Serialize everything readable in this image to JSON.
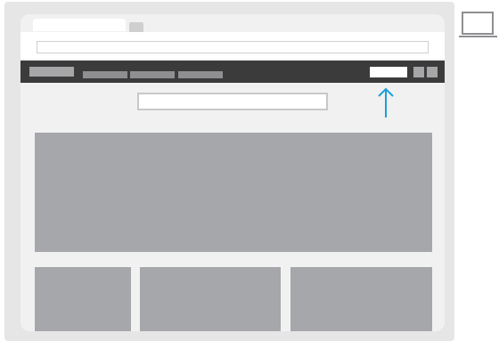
{
  "browser": {
    "tabs": [
      {
        "label": "",
        "active": true
      },
      {
        "label": "",
        "active": false
      }
    ],
    "address_bar": {
      "value": ""
    }
  },
  "site": {
    "navbar": {
      "logo": "",
      "items": [
        "",
        "",
        ""
      ],
      "primary_button": "",
      "icon_buttons": [
        "",
        ""
      ]
    },
    "search": {
      "value": "",
      "placeholder": ""
    }
  },
  "annotation": {
    "type": "arrow-up",
    "color": "#1aa0d8"
  },
  "device_icon": "laptop-icon",
  "colors": {
    "navbar_bg": "#3b3b3c",
    "placeholder_block": "#a6a7aa",
    "window_bg": "#f1f1f2",
    "accent": "#1aa0d8"
  }
}
